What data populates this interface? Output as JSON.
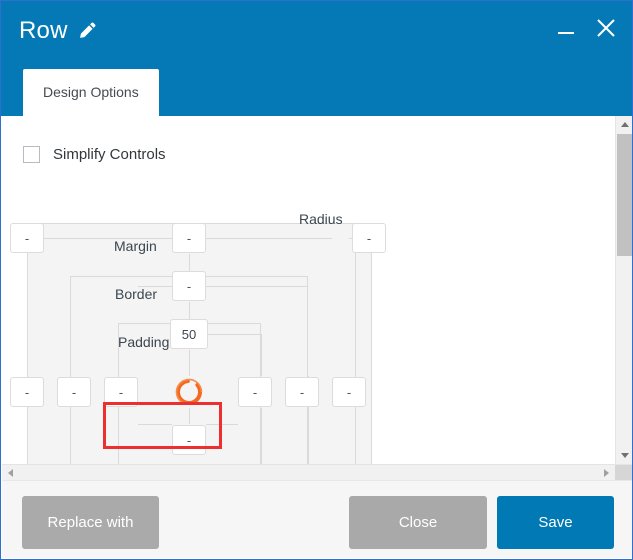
{
  "window": {
    "title": "Row",
    "edit_icon": "pencil-icon",
    "minimize_icon": "minimize-icon",
    "close_icon": "close-icon"
  },
  "tabs": [
    {
      "label": "Design Options",
      "active": true
    }
  ],
  "content": {
    "simplify_controls": {
      "label": "Simplify Controls",
      "checked": false
    },
    "box_model": {
      "labels": {
        "margin": "Margin",
        "border": "Border",
        "padding": "Padding",
        "radius": "Radius"
      },
      "fields": {
        "margin_top": "-",
        "margin_right": "-",
        "margin_bottom": "-",
        "margin_left": "-",
        "border_top": "-",
        "border_right": "-",
        "border_bottom": "-",
        "border_left": "-",
        "padding_top": "50",
        "padding_right": "-",
        "padding_bottom": "-",
        "padding_left": "-",
        "radius": "-"
      },
      "placeholder": "-",
      "highlight_target": "padding_top",
      "highlight_color": "#ec2f2f",
      "spinner": {
        "icon": "loading-spinner-icon",
        "color": "#f26a21"
      }
    }
  },
  "footer": {
    "replace_label": "Replace with",
    "close_label": "Close",
    "save_label": "Save"
  },
  "colors": {
    "header_blue": "#0479b5",
    "accent_blue": "#0079b4",
    "button_gray": "#aaaaaa",
    "highlight_red": "#ec2f2f",
    "spinner_orange": "#f26a21"
  },
  "scrollbars": {
    "vertical": {
      "up": "scroll-up-arrow-icon",
      "down": "scroll-down-arrow-icon"
    },
    "horizontal": {
      "left": "scroll-left-arrow-icon",
      "right": "scroll-right-arrow-icon"
    }
  }
}
